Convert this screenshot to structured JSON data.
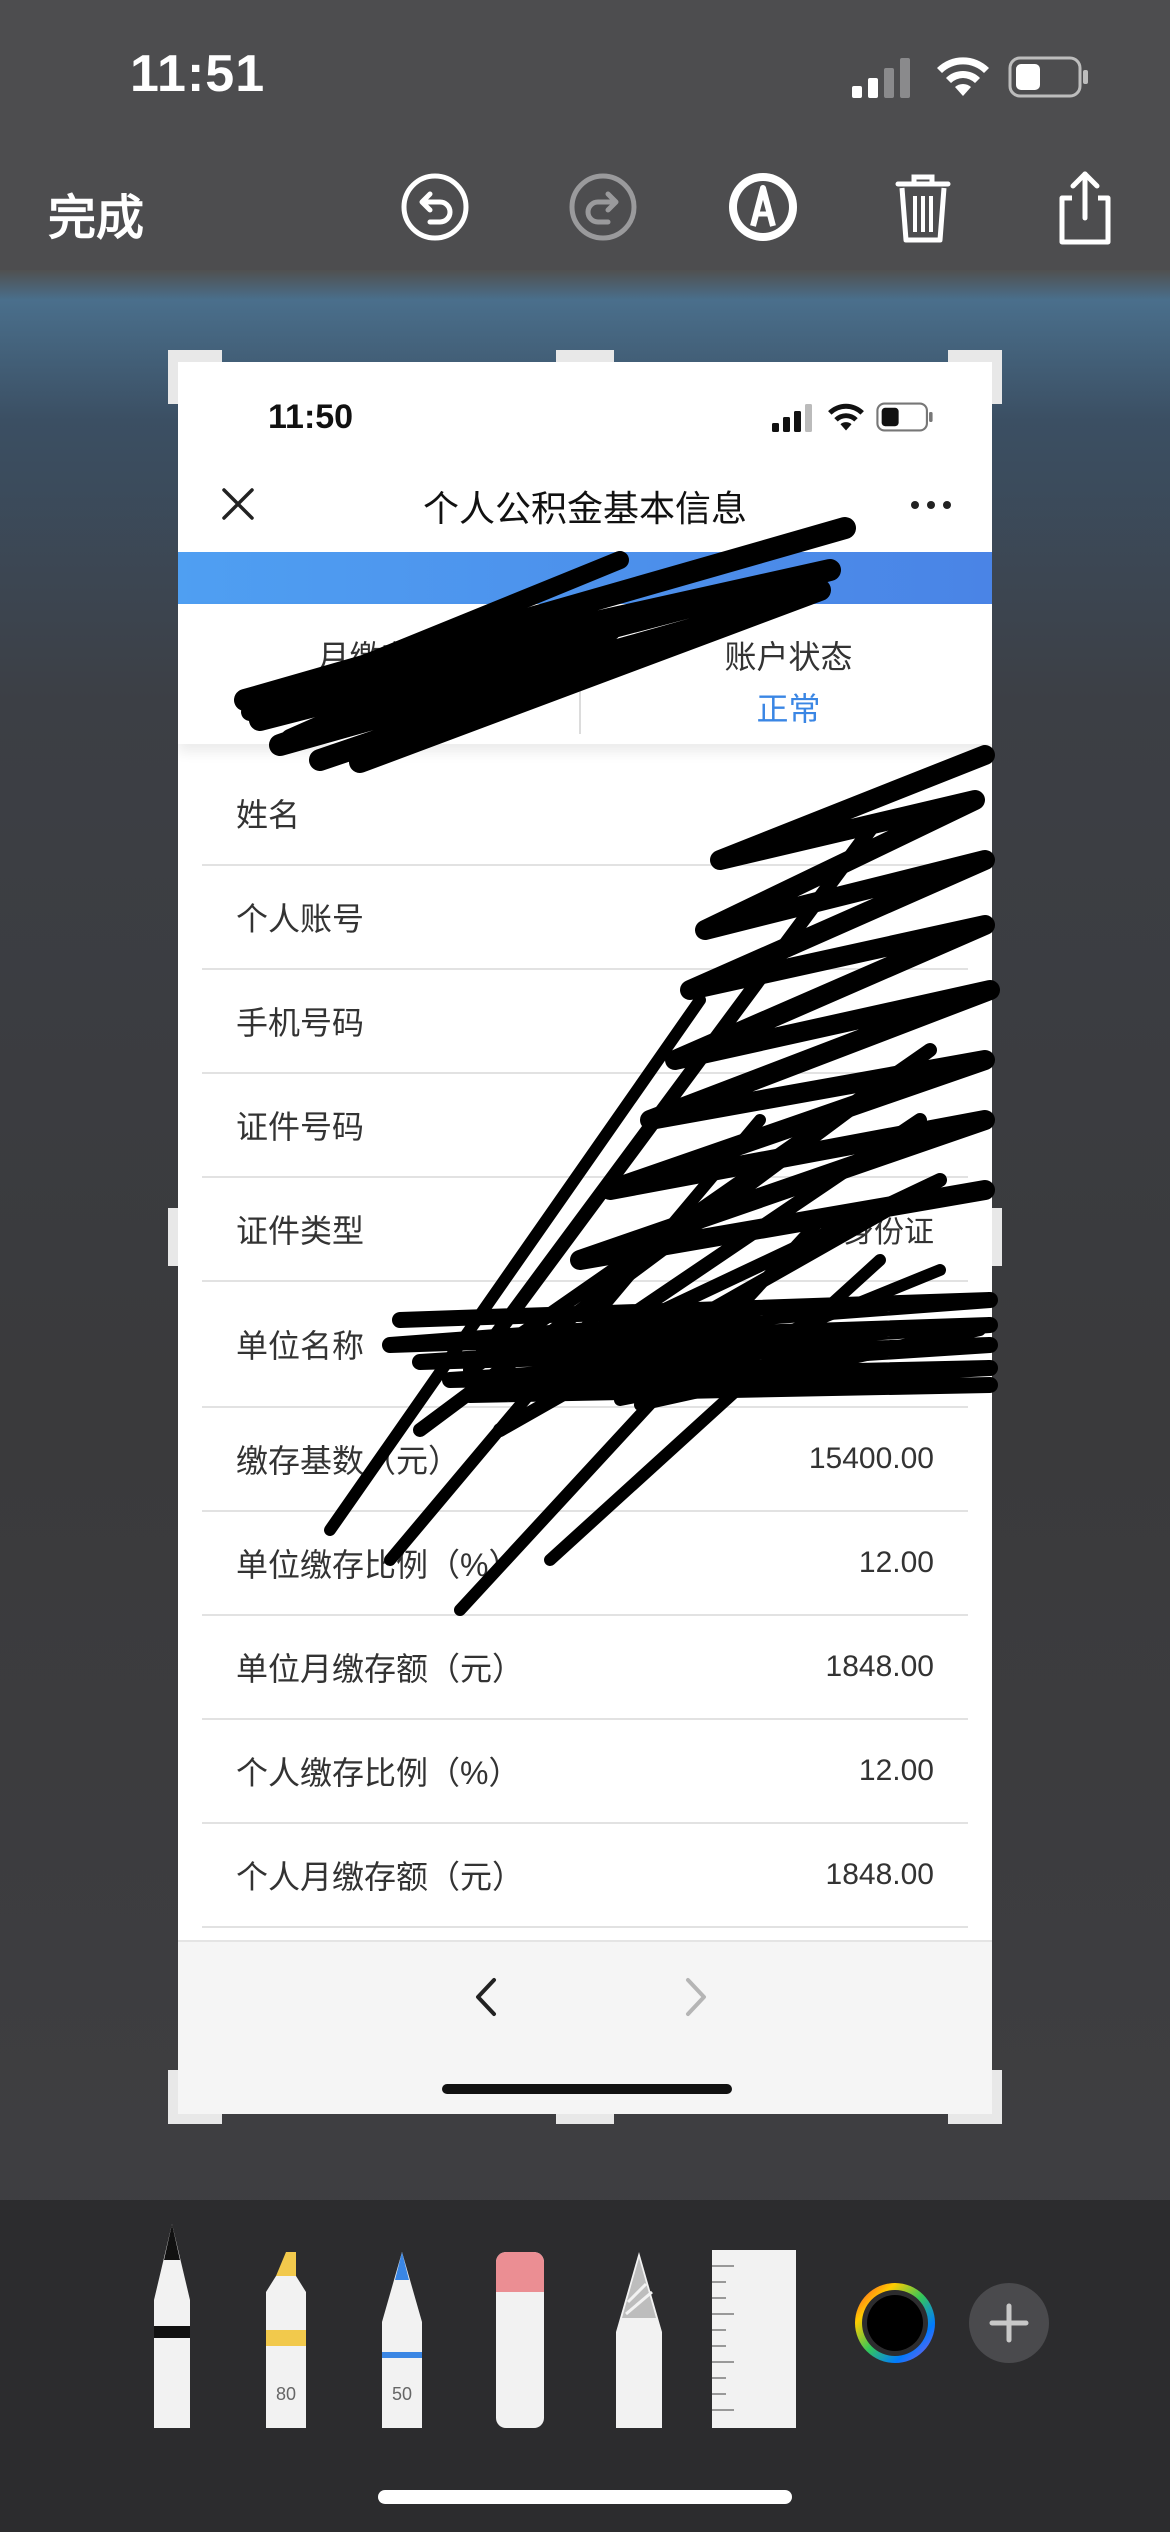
{
  "status_bar": {
    "time": "11:51"
  },
  "toolbar": {
    "done_label": "完成",
    "icons": [
      "undo-icon",
      "redo-icon",
      "markup-pen-icon",
      "trash-icon",
      "share-icon"
    ]
  },
  "screenshot": {
    "status_time": "11:50",
    "title": "个人公积金基本信息",
    "summary": [
      {
        "label": "月缴存额",
        "value": ""
      },
      {
        "label": "账户状态",
        "value": "正常"
      }
    ],
    "rows": [
      {
        "label": "姓名",
        "value": ""
      },
      {
        "label": "个人账号",
        "value": ""
      },
      {
        "label": "手机号码",
        "value": ""
      },
      {
        "label": "证件号码",
        "value": ""
      },
      {
        "label": "证件类型",
        "value": "身份证"
      },
      {
        "label": "单位名称",
        "value": ""
      },
      {
        "label": "缴存基数（元）",
        "value": "15400.00"
      },
      {
        "label": "单位缴存比例（%）",
        "value": "12.00"
      },
      {
        "label": "单位月缴存额（元）",
        "value": "1848.00"
      },
      {
        "label": "个人缴存比例（%）",
        "value": "12.00"
      },
      {
        "label": "个人月缴存额（元）",
        "value": "1848.00"
      }
    ],
    "accent_color": "#3a86e4"
  },
  "palette": {
    "highlighter_opacity": "80",
    "pencil_width": "50"
  }
}
